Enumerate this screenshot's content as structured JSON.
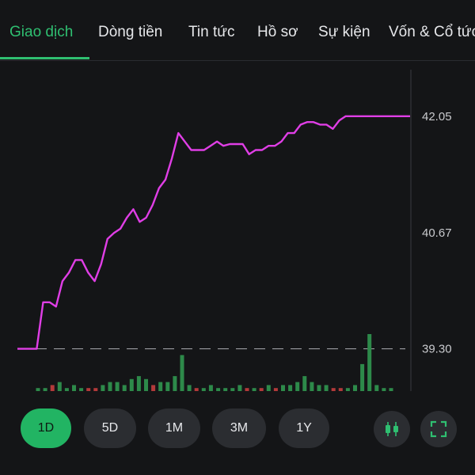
{
  "tabs": [
    {
      "label": "Giao dịch",
      "active": true
    },
    {
      "label": "Dòng tiền",
      "active": false
    },
    {
      "label": "Tin tức",
      "active": false
    },
    {
      "label": "Hồ sơ",
      "active": false
    },
    {
      "label": "Sự kiện",
      "active": false
    },
    {
      "label": "Vốn & Cổ tức",
      "active": false
    }
  ],
  "colors": {
    "accent": "#2fbf71",
    "price_line": "#e03ee6",
    "volume_up": "#2d8a4a",
    "volume_down": "#b33a3a",
    "reference_line": "#9a9ba0"
  },
  "chart_data": {
    "type": "line",
    "price_labels": [
      "42.05",
      "40.67",
      "39.30"
    ],
    "reference_price": 39.3,
    "ylim": [
      38.8,
      42.6
    ],
    "series": [
      {
        "values": [
          39.3,
          39.3,
          39.3,
          39.3,
          39.85,
          39.85,
          39.8,
          40.1,
          40.2,
          40.35,
          40.35,
          40.2,
          40.1,
          40.3,
          40.6,
          40.67,
          40.72,
          40.85,
          40.95,
          40.8,
          40.85,
          41.0,
          41.2,
          41.3,
          41.55,
          41.85,
          41.75,
          41.65,
          41.65,
          41.65,
          41.7,
          41.75,
          41.7,
          41.72,
          41.72,
          41.72,
          41.6,
          41.65,
          41.65,
          41.7,
          41.7,
          41.75,
          41.85,
          41.85,
          41.95,
          41.98,
          41.98,
          41.95,
          41.95,
          41.9,
          42.0,
          42.05,
          42.05,
          42.05,
          42.05,
          42.05,
          42.05,
          42.05,
          42.05,
          42.05,
          42.05,
          42.05
        ]
      }
    ],
    "volume": {
      "values": [
        1,
        1,
        2,
        3,
        1,
        2,
        1,
        1,
        1,
        2,
        3,
        3,
        2,
        4,
        5,
        4,
        2,
        3,
        3,
        5,
        12,
        2,
        1,
        1,
        2,
        1,
        1,
        1,
        2,
        1,
        1,
        1,
        2,
        1,
        2,
        2,
        3,
        5,
        3,
        2,
        2,
        1,
        1,
        1,
        2,
        9,
        19,
        2,
        1,
        1
      ],
      "direction": [
        "up",
        "up",
        "down",
        "up",
        "up",
        "up",
        "up",
        "down",
        "down",
        "up",
        "up",
        "up",
        "up",
        "up",
        "up",
        "up",
        "down",
        "up",
        "up",
        "up",
        "up",
        "up",
        "down",
        "up",
        "up",
        "up",
        "up",
        "up",
        "up",
        "down",
        "up",
        "down",
        "up",
        "down",
        "up",
        "up",
        "up",
        "up",
        "up",
        "up",
        "up",
        "down",
        "down",
        "up",
        "up",
        "up",
        "up",
        "up",
        "up",
        "up"
      ]
    }
  },
  "ranges": [
    {
      "label": "1D",
      "active": true
    },
    {
      "label": "5D",
      "active": false
    },
    {
      "label": "1M",
      "active": false
    },
    {
      "label": "3M",
      "active": false
    },
    {
      "label": "1Y",
      "active": false
    }
  ],
  "icons": {
    "candle": "candlestick-icon",
    "fullscreen": "fullscreen-icon"
  }
}
